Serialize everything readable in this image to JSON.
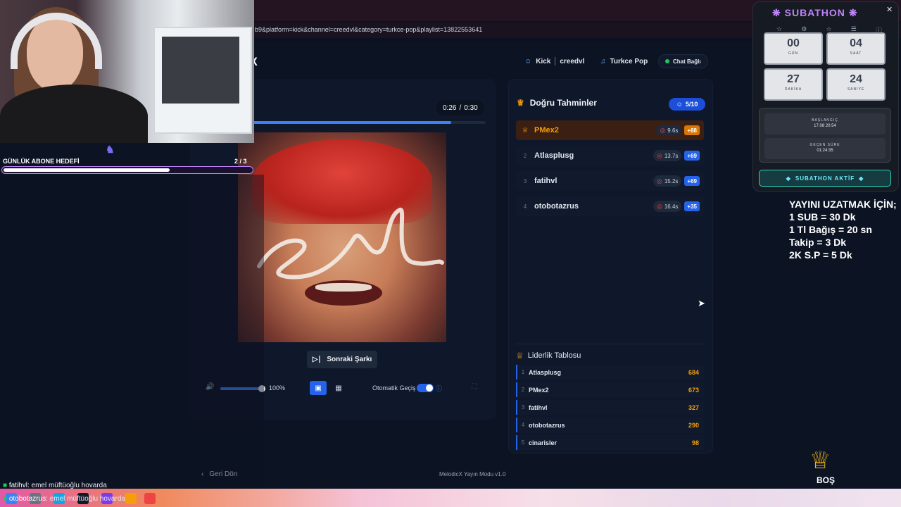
{
  "browser": {
    "url": "b9&platform=kick&channel=creedvl&category=turkce-pop&playlist=13822553641"
  },
  "header": {
    "brand": "cX",
    "platform": "Kick",
    "channel": "creedvl",
    "category": "Turkce Pop",
    "chat_status": "Chat Bağlı"
  },
  "player": {
    "current_time": "0:26",
    "total_time": "0:30",
    "time_separator": "/",
    "progress": 0.85,
    "next_button": "Sonraki Şarkı",
    "volume_percent": "100%",
    "volume_level": 1.0,
    "auto_label": "Otomatik Geçiş",
    "auto_enabled": true,
    "view_mode_active": "screen"
  },
  "guesses": {
    "title": "Doğru Tahminler",
    "count": "5/10",
    "rows": [
      {
        "rank": "1",
        "name": "PMex2",
        "time": "9.6s",
        "points": "+88"
      },
      {
        "rank": "2",
        "name": "Atlasplusg",
        "time": "13.7s",
        "points": "+69"
      },
      {
        "rank": "3",
        "name": "fatihvl",
        "time": "15.2s",
        "points": "+69"
      },
      {
        "rank": "4",
        "name": "otobotazrus",
        "time": "16.4s",
        "points": "+35"
      }
    ]
  },
  "leaderboard": {
    "title": "Liderlik Tablosu",
    "rows": [
      {
        "rank": "1",
        "name": "Atlasplusg",
        "score": "684"
      },
      {
        "rank": "2",
        "name": "PMex2",
        "score": "673"
      },
      {
        "rank": "3",
        "name": "fatihvl",
        "score": "327"
      },
      {
        "rank": "4",
        "name": "otobotazrus",
        "score": "290"
      },
      {
        "rank": "5",
        "name": "cinarisler",
        "score": "98"
      }
    ]
  },
  "footer": {
    "back": "Geri Dön",
    "version": "MelodicX Yayın Modu v1.0"
  },
  "overlay": {
    "goal_label": "GÜNLÜK ABONE HEDEFİ",
    "goal_count": "2 / 3",
    "goal_progress": 0.67
  },
  "subathon": {
    "title": "SUBATHON",
    "days": "00",
    "days_label": "GÜN",
    "hours": "04",
    "hours_label": "SAAT",
    "minutes": "27",
    "minutes_label": "DAKİKA",
    "seconds": "24",
    "seconds_label": "SANİYE",
    "start_label": "BAŞLANGIÇ",
    "start_value": "17.08 20:54",
    "elapsed_label": "GEÇEN SÜRE",
    "elapsed_value": "01:24:35",
    "status": "SUBATHON AKTİF"
  },
  "rules": {
    "title": "YAYINI UZATMAK İÇİN;",
    "lines": [
      "1 SUB = 30 Dk",
      "1 Tl Bağış = 20 sn",
      "Takip = 3 Dk",
      "2K S.P = 5 Dk"
    ]
  },
  "crown_label": "BOŞ",
  "chat": [
    {
      "user": "fatihvl:",
      "message": "emel müftüoğlu hovarda"
    },
    {
      "user": "otobotazrus:",
      "message": "emel müftüoğlu hovarda"
    }
  ],
  "colors": {
    "accent": "#2563eb",
    "gold": "#f59e0b",
    "subathon": "#c084fc"
  }
}
